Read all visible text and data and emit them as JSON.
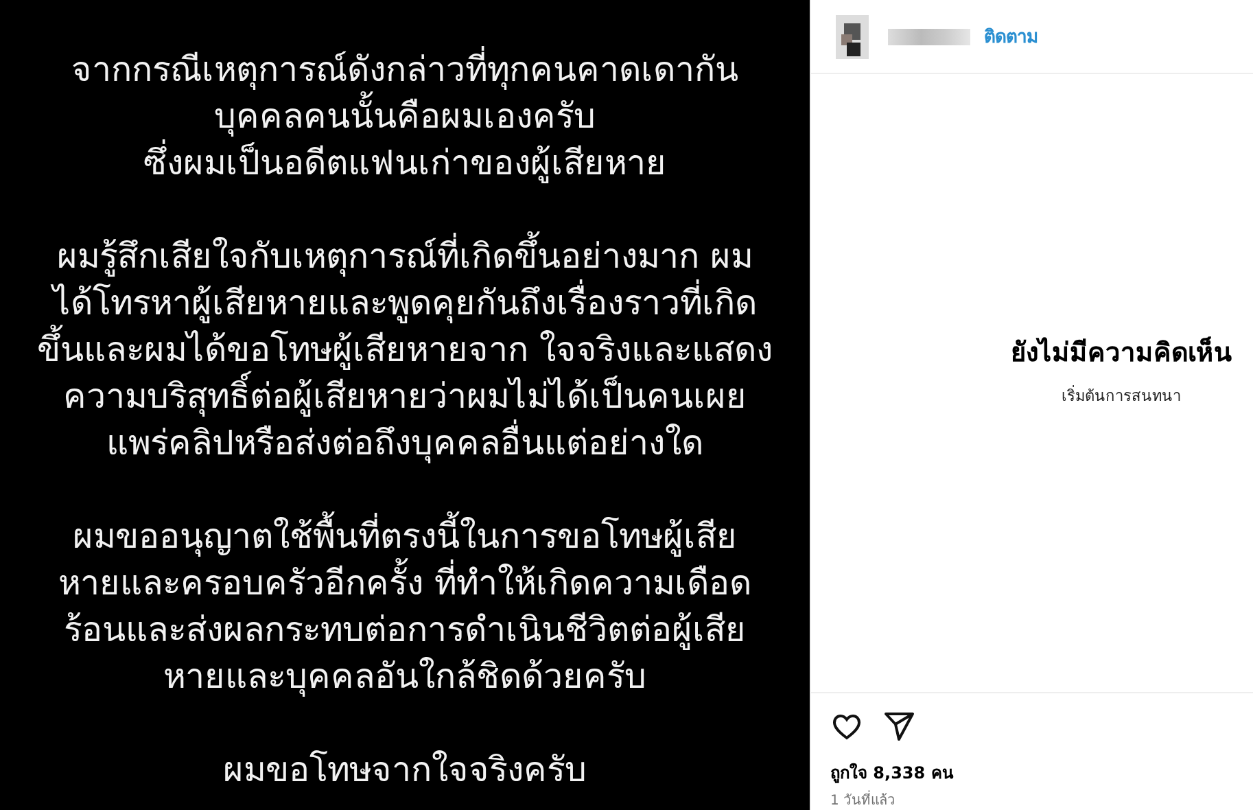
{
  "post": {
    "paragraphs": [
      {
        "lines": [
          "จากกรณีเหตุการณ์ดังกล่าวที่ทุกคนคาดเดากัน",
          "บุคคลคนนั้นคือผมเองครับ",
          "ซึ่งผมเป็นอดีตแฟนเก่าของผู้เสียหาย"
        ]
      },
      {
        "lines": [
          "ผมรู้สึกเสียใจกับเหตุการณ์ที่เกิดขึ้นอย่างมาก ผม",
          "ได้โทรหาผู้เสียหายและพูดคุยกันถึงเรื่องราวที่เกิด",
          "ขึ้นและผมได้ขอโทษผู้เสียหายจาก ใจจริงและแสดง",
          "ความบริสุทธิ์ต่อผู้เสียหายว่าผมไม่ได้เป็นคนเผย",
          "แพร่คลิปหรือส่งต่อถึงบุคคลอื่นแต่อย่างใด"
        ]
      },
      {
        "lines": [
          "ผมขออนุญาตใช้พื้นที่ตรงนี้ในการขอโทษผู้เสีย",
          "หายและครอบครัวอีกครั้ง ที่ทำให้เกิดความเดือด",
          "ร้อนและส่งผลกระทบต่อการดำเนินชีวิตต่อผู้เสีย",
          "หายและบุคคลอันใกล้ชิดด้วยครับ"
        ]
      },
      {
        "lines": [
          "ผมขอโทษจากใจจริงครับ"
        ]
      }
    ]
  },
  "header": {
    "follow": "ติดตาม"
  },
  "comments": {
    "empty_title": "ยังไม่มีความคิดเห็น",
    "empty_hint": "เริ่มต้นการสนทนา"
  },
  "footer": {
    "likes": "ถูกใจ 8,338 คน",
    "time": "1 วันที่แล้ว"
  }
}
